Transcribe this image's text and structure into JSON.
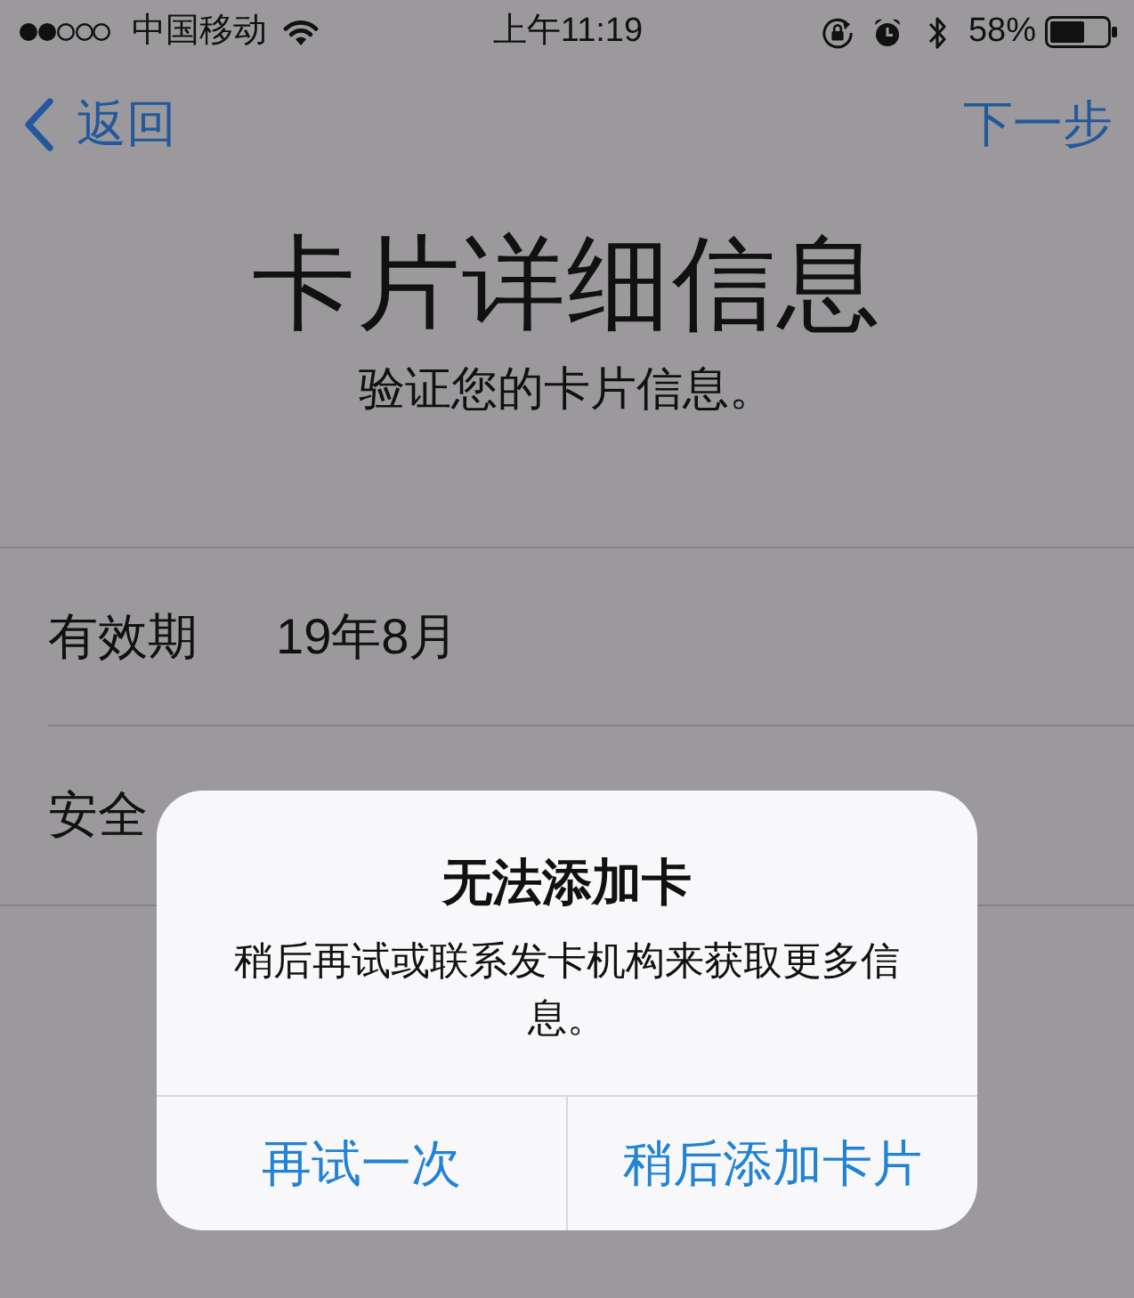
{
  "status_bar": {
    "carrier": "中国移动",
    "time": "上午11:19",
    "battery": "58%"
  },
  "nav": {
    "back": "返回",
    "next": "下一步"
  },
  "header": {
    "title": "卡片详细信息",
    "subtitle": "验证您的卡片信息。"
  },
  "rows": [
    {
      "label": "有效期",
      "value": "19年8月"
    },
    {
      "label": "安全"
    }
  ],
  "alert": {
    "title": "无法添加卡",
    "message": "稍后再试或联系发卡机构来获取更多信息。",
    "buttons": [
      {
        "label": "再试一次"
      },
      {
        "label": "稍后添加卡片"
      }
    ]
  }
}
